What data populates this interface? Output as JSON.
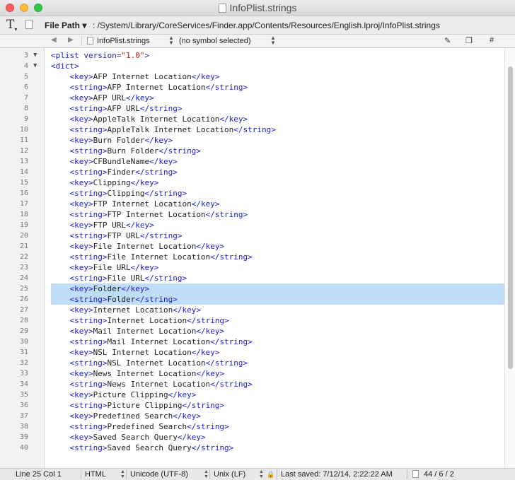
{
  "window": {
    "title": "InfoPlist.strings"
  },
  "toolbar": {
    "text_tool_icon": "T",
    "file_path_label": "File Path ▾",
    "path": ": /System/Library/CoreServices/Finder.app/Contents/Resources/English.lproj/InfoPlist.strings"
  },
  "navbar": {
    "back_icon": "◀",
    "forward_icon": "▶",
    "file": "InfoPlist.strings",
    "symbol": "(no symbol selected)",
    "pen_icon": "✎",
    "docs_icon": "❐",
    "hash_icon": "#"
  },
  "editor": {
    "lines": [
      {
        "num": "3",
        "fold": "▼",
        "tokens": [
          {
            "t": "<plist ",
            "c": "tag"
          },
          {
            "t": "version=",
            "c": "attr"
          },
          {
            "t": "\"1.0\"",
            "c": "val"
          },
          {
            "t": ">",
            "c": "tag"
          }
        ]
      },
      {
        "num": "4",
        "fold": "▼",
        "tokens": [
          {
            "t": "<dict>",
            "c": "tag"
          }
        ]
      },
      {
        "num": "5",
        "fold": "",
        "tokens": [
          {
            "t": "    ",
            "c": ""
          },
          {
            "t": "<key>",
            "c": "tag"
          },
          {
            "t": "AFP Internet Location",
            "c": ""
          },
          {
            "t": "</key>",
            "c": "tag"
          }
        ]
      },
      {
        "num": "6",
        "fold": "",
        "tokens": [
          {
            "t": "    ",
            "c": ""
          },
          {
            "t": "<string>",
            "c": "tag"
          },
          {
            "t": "AFP Internet Location",
            "c": ""
          },
          {
            "t": "</string>",
            "c": "tag"
          }
        ]
      },
      {
        "num": "7",
        "fold": "",
        "tokens": [
          {
            "t": "    ",
            "c": ""
          },
          {
            "t": "<key>",
            "c": "tag"
          },
          {
            "t": "AFP URL",
            "c": ""
          },
          {
            "t": "</key>",
            "c": "tag"
          }
        ]
      },
      {
        "num": "8",
        "fold": "",
        "tokens": [
          {
            "t": "    ",
            "c": ""
          },
          {
            "t": "<string>",
            "c": "tag"
          },
          {
            "t": "AFP URL",
            "c": ""
          },
          {
            "t": "</string>",
            "c": "tag"
          }
        ]
      },
      {
        "num": "9",
        "fold": "",
        "tokens": [
          {
            "t": "    ",
            "c": ""
          },
          {
            "t": "<key>",
            "c": "tag"
          },
          {
            "t": "AppleTalk Internet Location",
            "c": ""
          },
          {
            "t": "</key>",
            "c": "tag"
          }
        ]
      },
      {
        "num": "10",
        "fold": "",
        "tokens": [
          {
            "t": "    ",
            "c": ""
          },
          {
            "t": "<string>",
            "c": "tag"
          },
          {
            "t": "AppleTalk Internet Location",
            "c": ""
          },
          {
            "t": "</string>",
            "c": "tag"
          }
        ]
      },
      {
        "num": "11",
        "fold": "",
        "tokens": [
          {
            "t": "    ",
            "c": ""
          },
          {
            "t": "<key>",
            "c": "tag"
          },
          {
            "t": "Burn Folder",
            "c": ""
          },
          {
            "t": "</key>",
            "c": "tag"
          }
        ]
      },
      {
        "num": "12",
        "fold": "",
        "tokens": [
          {
            "t": "    ",
            "c": ""
          },
          {
            "t": "<string>",
            "c": "tag"
          },
          {
            "t": "Burn Folder",
            "c": ""
          },
          {
            "t": "</string>",
            "c": "tag"
          }
        ]
      },
      {
        "num": "13",
        "fold": "",
        "tokens": [
          {
            "t": "    ",
            "c": ""
          },
          {
            "t": "<key>",
            "c": "tag"
          },
          {
            "t": "CFBundleName",
            "c": ""
          },
          {
            "t": "</key>",
            "c": "tag"
          }
        ]
      },
      {
        "num": "14",
        "fold": "",
        "tokens": [
          {
            "t": "    ",
            "c": ""
          },
          {
            "t": "<string>",
            "c": "tag"
          },
          {
            "t": "Finder",
            "c": ""
          },
          {
            "t": "</string>",
            "c": "tag"
          }
        ]
      },
      {
        "num": "15",
        "fold": "",
        "tokens": [
          {
            "t": "    ",
            "c": ""
          },
          {
            "t": "<key>",
            "c": "tag"
          },
          {
            "t": "Clipping",
            "c": ""
          },
          {
            "t": "</key>",
            "c": "tag"
          }
        ]
      },
      {
        "num": "16",
        "fold": "",
        "tokens": [
          {
            "t": "    ",
            "c": ""
          },
          {
            "t": "<string>",
            "c": "tag"
          },
          {
            "t": "Clipping",
            "c": ""
          },
          {
            "t": "</string>",
            "c": "tag"
          }
        ]
      },
      {
        "num": "17",
        "fold": "",
        "tokens": [
          {
            "t": "    ",
            "c": ""
          },
          {
            "t": "<key>",
            "c": "tag"
          },
          {
            "t": "FTP Internet Location",
            "c": ""
          },
          {
            "t": "</key>",
            "c": "tag"
          }
        ]
      },
      {
        "num": "18",
        "fold": "",
        "tokens": [
          {
            "t": "    ",
            "c": ""
          },
          {
            "t": "<string>",
            "c": "tag"
          },
          {
            "t": "FTP Internet Location",
            "c": ""
          },
          {
            "t": "</string>",
            "c": "tag"
          }
        ]
      },
      {
        "num": "19",
        "fold": "",
        "tokens": [
          {
            "t": "    ",
            "c": ""
          },
          {
            "t": "<key>",
            "c": "tag"
          },
          {
            "t": "FTP URL",
            "c": ""
          },
          {
            "t": "</key>",
            "c": "tag"
          }
        ]
      },
      {
        "num": "20",
        "fold": "",
        "tokens": [
          {
            "t": "    ",
            "c": ""
          },
          {
            "t": "<string>",
            "c": "tag"
          },
          {
            "t": "FTP URL",
            "c": ""
          },
          {
            "t": "</string>",
            "c": "tag"
          }
        ]
      },
      {
        "num": "21",
        "fold": "",
        "tokens": [
          {
            "t": "    ",
            "c": ""
          },
          {
            "t": "<key>",
            "c": "tag"
          },
          {
            "t": "File Internet Location",
            "c": ""
          },
          {
            "t": "</key>",
            "c": "tag"
          }
        ]
      },
      {
        "num": "22",
        "fold": "",
        "tokens": [
          {
            "t": "    ",
            "c": ""
          },
          {
            "t": "<string>",
            "c": "tag"
          },
          {
            "t": "File Internet Location",
            "c": ""
          },
          {
            "t": "</string>",
            "c": "tag"
          }
        ]
      },
      {
        "num": "23",
        "fold": "",
        "tokens": [
          {
            "t": "    ",
            "c": ""
          },
          {
            "t": "<key>",
            "c": "tag"
          },
          {
            "t": "File URL",
            "c": ""
          },
          {
            "t": "</key>",
            "c": "tag"
          }
        ]
      },
      {
        "num": "24",
        "fold": "",
        "tokens": [
          {
            "t": "    ",
            "c": ""
          },
          {
            "t": "<string>",
            "c": "tag"
          },
          {
            "t": "File URL",
            "c": ""
          },
          {
            "t": "</string>",
            "c": "tag"
          }
        ]
      },
      {
        "num": "25",
        "fold": "",
        "selected": true,
        "tokens": [
          {
            "t": "    ",
            "c": ""
          },
          {
            "t": "<key>",
            "c": "tag"
          },
          {
            "t": "Folder",
            "c": ""
          },
          {
            "t": "</key>",
            "c": "tag"
          }
        ]
      },
      {
        "num": "26",
        "fold": "",
        "selected": true,
        "tokens": [
          {
            "t": "    ",
            "c": ""
          },
          {
            "t": "<string>",
            "c": "tag"
          },
          {
            "t": "Folder",
            "c": ""
          },
          {
            "t": "</string>",
            "c": "tag"
          }
        ]
      },
      {
        "num": "27",
        "fold": "",
        "tokens": [
          {
            "t": "    ",
            "c": ""
          },
          {
            "t": "<key>",
            "c": "tag"
          },
          {
            "t": "Internet Location",
            "c": ""
          },
          {
            "t": "</key>",
            "c": "tag"
          }
        ]
      },
      {
        "num": "28",
        "fold": "",
        "tokens": [
          {
            "t": "    ",
            "c": ""
          },
          {
            "t": "<string>",
            "c": "tag"
          },
          {
            "t": "Internet Location",
            "c": ""
          },
          {
            "t": "</string>",
            "c": "tag"
          }
        ]
      },
      {
        "num": "29",
        "fold": "",
        "tokens": [
          {
            "t": "    ",
            "c": ""
          },
          {
            "t": "<key>",
            "c": "tag"
          },
          {
            "t": "Mail Internet Location",
            "c": ""
          },
          {
            "t": "</key>",
            "c": "tag"
          }
        ]
      },
      {
        "num": "30",
        "fold": "",
        "tokens": [
          {
            "t": "    ",
            "c": ""
          },
          {
            "t": "<string>",
            "c": "tag"
          },
          {
            "t": "Mail Internet Location",
            "c": ""
          },
          {
            "t": "</string>",
            "c": "tag"
          }
        ]
      },
      {
        "num": "31",
        "fold": "",
        "tokens": [
          {
            "t": "    ",
            "c": ""
          },
          {
            "t": "<key>",
            "c": "tag"
          },
          {
            "t": "NSL Internet Location",
            "c": ""
          },
          {
            "t": "</key>",
            "c": "tag"
          }
        ]
      },
      {
        "num": "32",
        "fold": "",
        "tokens": [
          {
            "t": "    ",
            "c": ""
          },
          {
            "t": "<string>",
            "c": "tag"
          },
          {
            "t": "NSL Internet Location",
            "c": ""
          },
          {
            "t": "</string>",
            "c": "tag"
          }
        ]
      },
      {
        "num": "33",
        "fold": "",
        "tokens": [
          {
            "t": "    ",
            "c": ""
          },
          {
            "t": "<key>",
            "c": "tag"
          },
          {
            "t": "News Internet Location",
            "c": ""
          },
          {
            "t": "</key>",
            "c": "tag"
          }
        ]
      },
      {
        "num": "34",
        "fold": "",
        "tokens": [
          {
            "t": "    ",
            "c": ""
          },
          {
            "t": "<string>",
            "c": "tag"
          },
          {
            "t": "News Internet Location",
            "c": ""
          },
          {
            "t": "</string>",
            "c": "tag"
          }
        ]
      },
      {
        "num": "35",
        "fold": "",
        "tokens": [
          {
            "t": "    ",
            "c": ""
          },
          {
            "t": "<key>",
            "c": "tag"
          },
          {
            "t": "Picture Clipping",
            "c": ""
          },
          {
            "t": "</key>",
            "c": "tag"
          }
        ]
      },
      {
        "num": "36",
        "fold": "",
        "tokens": [
          {
            "t": "    ",
            "c": ""
          },
          {
            "t": "<string>",
            "c": "tag"
          },
          {
            "t": "Picture Clipping",
            "c": ""
          },
          {
            "t": "</string>",
            "c": "tag"
          }
        ]
      },
      {
        "num": "37",
        "fold": "",
        "tokens": [
          {
            "t": "    ",
            "c": ""
          },
          {
            "t": "<key>",
            "c": "tag"
          },
          {
            "t": "Predefined Search",
            "c": ""
          },
          {
            "t": "</key>",
            "c": "tag"
          }
        ]
      },
      {
        "num": "38",
        "fold": "",
        "tokens": [
          {
            "t": "    ",
            "c": ""
          },
          {
            "t": "<string>",
            "c": "tag"
          },
          {
            "t": "Predefined Search",
            "c": ""
          },
          {
            "t": "</string>",
            "c": "tag"
          }
        ]
      },
      {
        "num": "39",
        "fold": "",
        "tokens": [
          {
            "t": "    ",
            "c": ""
          },
          {
            "t": "<key>",
            "c": "tag"
          },
          {
            "t": "Saved Search Query",
            "c": ""
          },
          {
            "t": "</key>",
            "c": "tag"
          }
        ]
      },
      {
        "num": "40",
        "fold": "",
        "tokens": [
          {
            "t": "    ",
            "c": ""
          },
          {
            "t": "<string>",
            "c": "tag"
          },
          {
            "t": "Saved Search Query",
            "c": ""
          },
          {
            "t": "</string>",
            "c": "tag"
          }
        ]
      }
    ]
  },
  "statusbar": {
    "position": "Line 25 Col 1",
    "language": "HTML",
    "encoding": "Unicode (UTF-8)",
    "line_endings": "Unix (LF)",
    "lock_icon": "🔒",
    "last_saved": "Last saved: 7/12/14, 2:22:22 AM",
    "counts": "44 / 6 / 2"
  },
  "colors": {
    "tag": "#1a1ad0",
    "value": "#c41a16",
    "selection": "#bfdcf9"
  }
}
